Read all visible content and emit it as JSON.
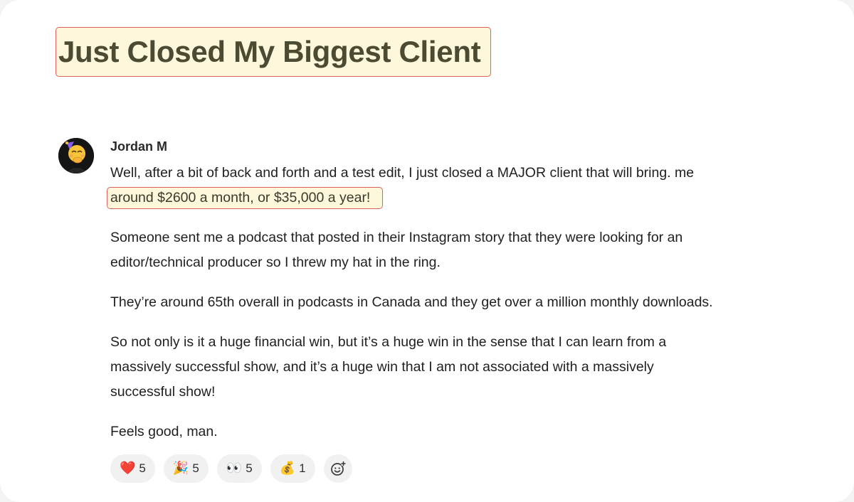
{
  "post": {
    "title": "Just Closed My Biggest Client",
    "author": "Jordan M",
    "avatar_icon": "face-with-hand-over-mouth-party-hat-emoji",
    "body": {
      "line1": "Well, after a bit of back and forth and a test edit, I just closed a MAJOR client that will bring. me",
      "line2_highlight": "around $2600 a month, or $35,000 a year!",
      "p2_line1": "Someone sent me a podcast that posted in their Instagram story that they were looking for an",
      "p2_line2": "editor/technical producer so I threw my hat in the ring.",
      "p3_line1": "They’re around 65th overall in podcasts in Canada and they get over a million monthly downloads.",
      "p4_line1": "So not only is it a huge financial win, but it’s a huge win in the sense that I can learn from a",
      "p4_line2": "massively successful show, and it’s a huge win that I am not associated with a massively",
      "p4_line3": "successful show!",
      "p5_line1": "Feels good, man."
    }
  },
  "reactions": [
    {
      "icon": "heart-icon",
      "emoji": "❤️",
      "count": "5"
    },
    {
      "icon": "party-popper-icon",
      "emoji": "🎉",
      "count": "5"
    },
    {
      "icon": "eyes-icon",
      "emoji": "👀",
      "count": "5"
    },
    {
      "icon": "money-bag-icon",
      "emoji": "💰",
      "count": "1"
    }
  ],
  "add_reaction_icon": "add-reaction-icon",
  "colors": {
    "highlight_fill": "#fdf7dc",
    "highlight_border": "#e0605a",
    "title_text": "#4b4a33"
  }
}
